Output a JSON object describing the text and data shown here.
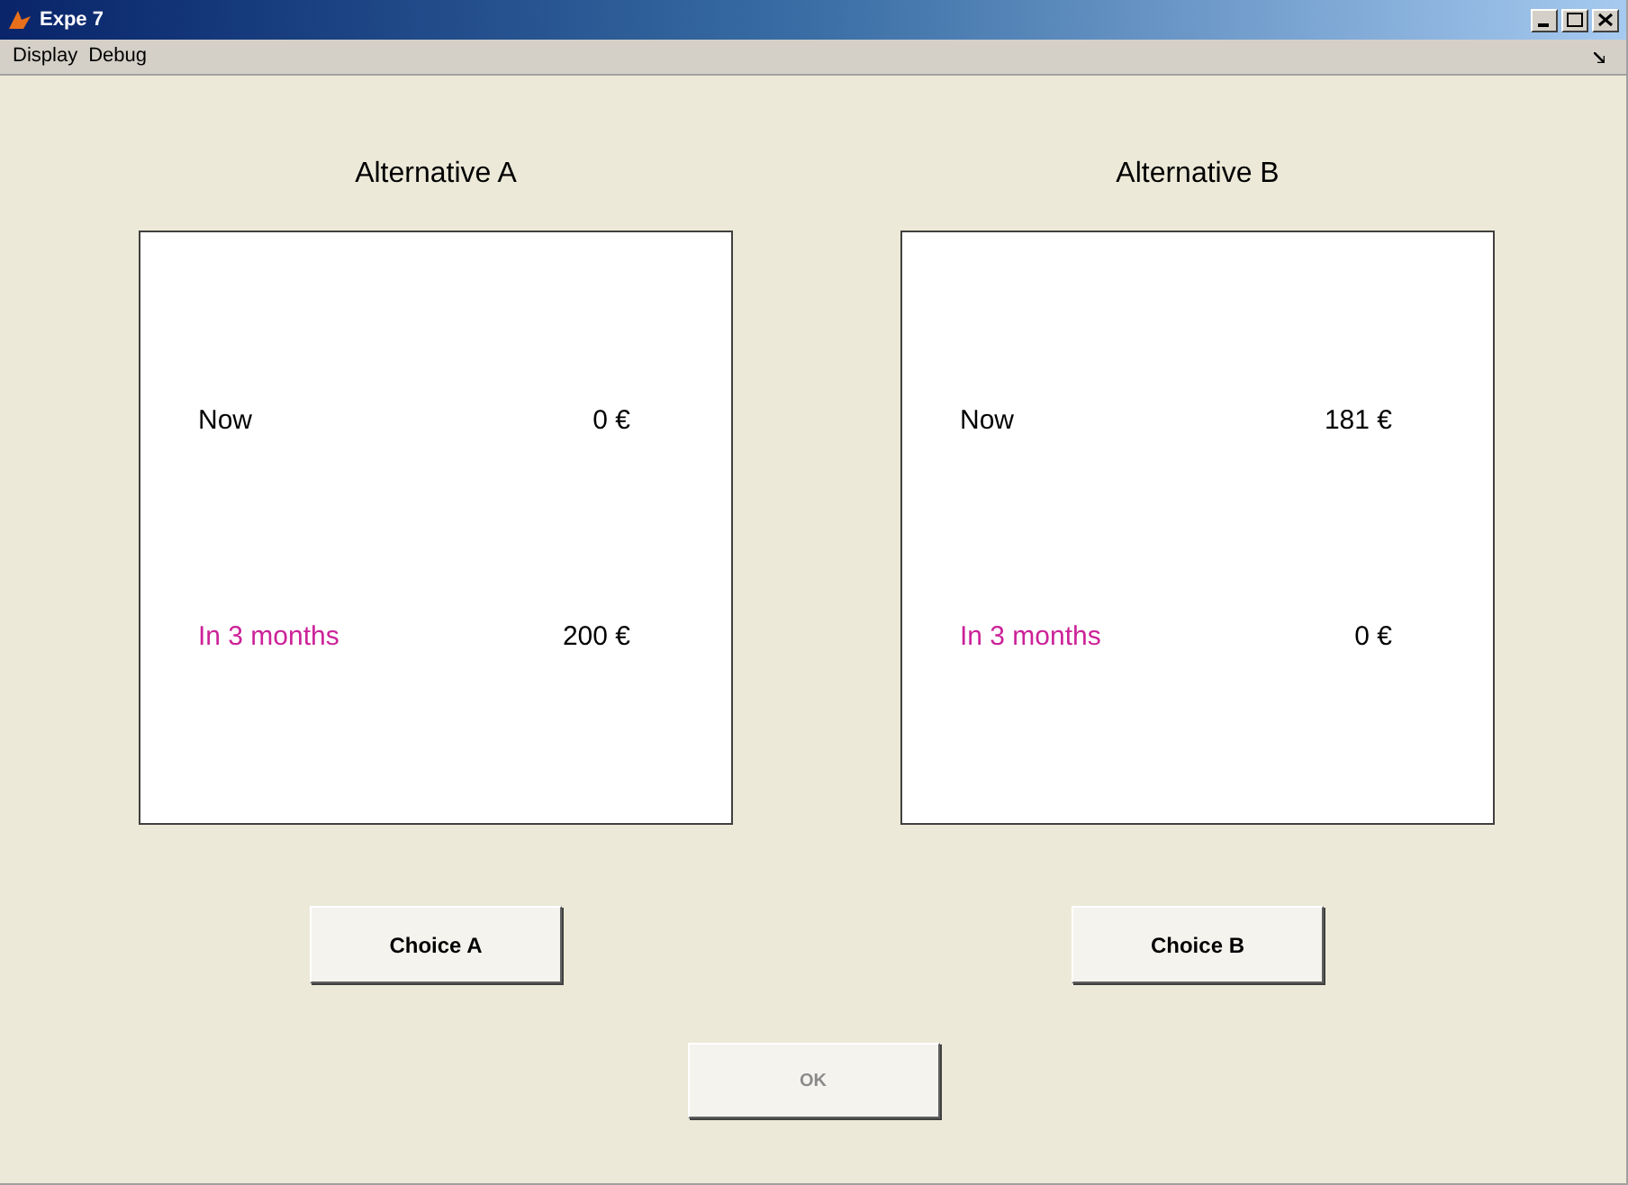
{
  "window": {
    "title": "Expe 7"
  },
  "menu": [
    "Display",
    "Debug"
  ],
  "alternatives": [
    {
      "title": "Alternative A",
      "rows": [
        {
          "label": "Now",
          "amount": "0 €",
          "color": "#000000"
        },
        {
          "label": "In 3 months",
          "amount": "200 €",
          "color": "#cc2299"
        }
      ],
      "button": "Choice A"
    },
    {
      "title": "Alternative B",
      "rows": [
        {
          "label": "Now",
          "amount": "181 €",
          "color": "#000000"
        },
        {
          "label": "In 3 months",
          "amount": "0 €",
          "color": "#cc2299"
        }
      ],
      "button": "Choice B"
    }
  ],
  "ok_button": {
    "label": "OK",
    "disabled": true
  }
}
